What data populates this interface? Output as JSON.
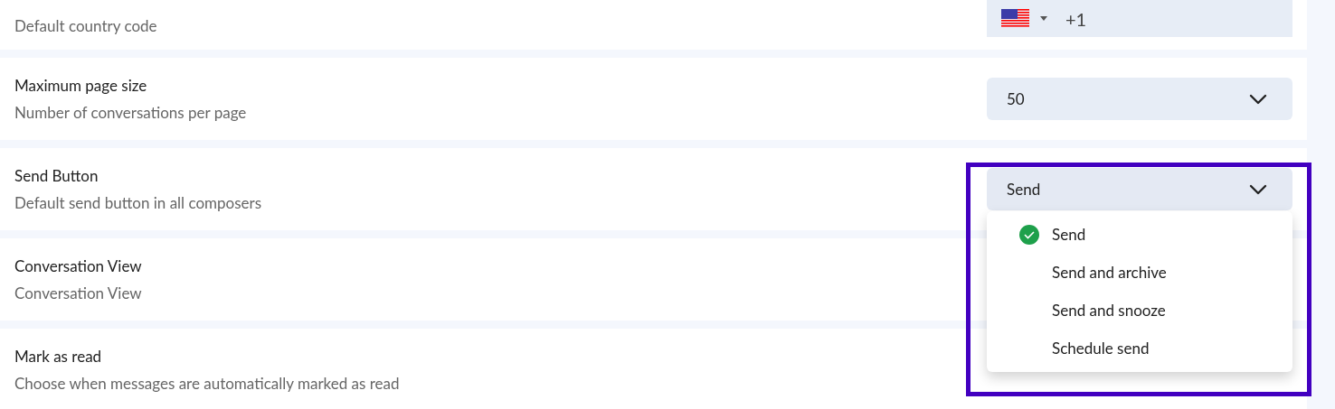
{
  "settings": [
    {
      "description": "Default country code",
      "control": {
        "kind": "phone",
        "value": "+1"
      }
    },
    {
      "label": "Maximum page size",
      "description": "Number of conversations per page",
      "control": {
        "kind": "select",
        "value": "50"
      }
    },
    {
      "label": "Send Button",
      "description": "Default send button in all composers",
      "control": {
        "kind": "select",
        "value": "Send",
        "expanded": true,
        "highlighted": true,
        "options": [
          {
            "label": "Send",
            "selected": true
          },
          {
            "label": "Send and archive",
            "selected": false
          },
          {
            "label": "Send and snooze",
            "selected": false
          },
          {
            "label": "Schedule send",
            "selected": false
          }
        ]
      }
    },
    {
      "label": "Conversation View",
      "description": "Conversation View"
    },
    {
      "label": "Mark as read",
      "description": "Choose when messages are automatically marked as read"
    }
  ]
}
